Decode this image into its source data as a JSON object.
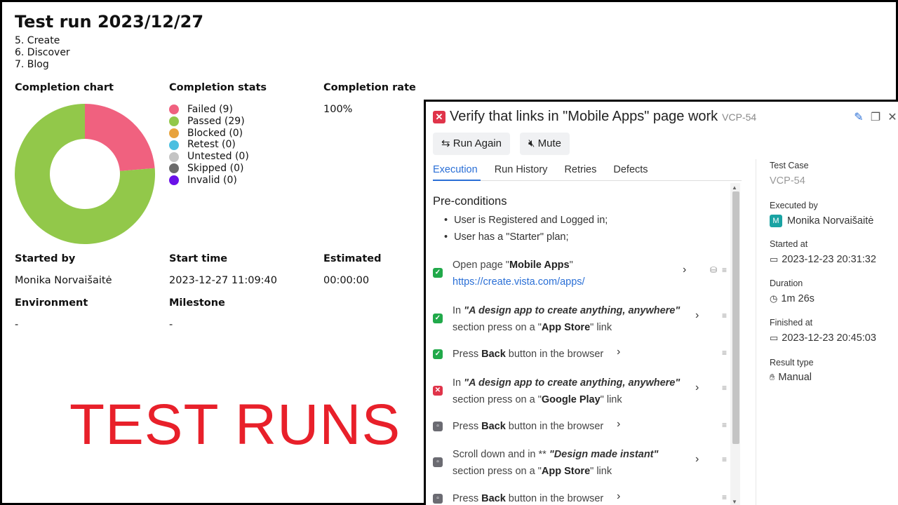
{
  "report": {
    "title": "Test run 2023/12/27",
    "sections": [
      "5. Create",
      "6. Discover",
      "7. Blog"
    ],
    "labels": {
      "completion_chart": "Completion chart",
      "completion_stats": "Completion stats",
      "completion_rate": "Completion rate",
      "started_by": "Started by",
      "start_time": "Start time",
      "estimated": "Estimated",
      "environment": "Environment",
      "milestone": "Milestone"
    },
    "values": {
      "completion_rate": "100%",
      "started_by": "Monika Norvaišaitė",
      "start_time": "2023-12-27 11:09:40",
      "estimated": "00:00:00",
      "environment": "-",
      "milestone": "-"
    },
    "stats": [
      {
        "label": "Failed (9)",
        "color": "#f0617f"
      },
      {
        "label": "Passed (29)",
        "color": "#92c84a"
      },
      {
        "label": "Blocked (0)",
        "color": "#e8a33d"
      },
      {
        "label": "Retest (0)",
        "color": "#4cbfe0"
      },
      {
        "label": "Untested (0)",
        "color": "#c4c4c4"
      },
      {
        "label": "Skipped (0)",
        "color": "#6b6b6b"
      },
      {
        "label": "Invalid (0)",
        "color": "#6a11e8"
      }
    ],
    "overlay_caption": "TEST RUNS"
  },
  "chart_data": {
    "type": "pie",
    "categories": [
      "Failed",
      "Passed"
    ],
    "values": [
      9,
      29
    ],
    "colors": [
      "#f0617f",
      "#92c84a"
    ],
    "title": "Completion chart",
    "donut": true
  },
  "panel": {
    "status_icon": "fail-icon",
    "title": "Verify that links in \"Mobile Apps\" page work",
    "case_id": "VCP-54",
    "buttons": {
      "run_again": "Run Again",
      "mute": "Mute"
    },
    "tabs": [
      "Execution",
      "Run History",
      "Retries",
      "Defects"
    ],
    "active_tab": "Execution",
    "preconditions_title": "Pre-conditions",
    "preconditions": [
      "User is Registered and Logged in;",
      "User has a \"Starter\" plan;"
    ],
    "steps": [
      {
        "status": "passed",
        "line1_pre": "Open page \"",
        "line1_bold": "Mobile Apps",
        "line1_post": "\"",
        "link": "https://create.vista.com/apps/"
      },
      {
        "status": "passed",
        "line1_pre": "In ",
        "line1_em": "\"A design app to create anything, anywhere\"",
        "line2_pre": "section press on a \"",
        "line2_bold": "App Store",
        "line2_post": "\" link"
      },
      {
        "status": "passed",
        "line1_pre": "Press ",
        "line1_bold": "Back",
        "line1_post": " button in the browser"
      },
      {
        "status": "failed",
        "line1_pre": "In ",
        "line1_em": "\"A design app to create anything, anywhere\"",
        "line2_pre": "section press on a \"",
        "line2_bold": "Google Play",
        "line2_post": "\" link"
      },
      {
        "status": "skipped",
        "line1_pre": "Press ",
        "line1_bold": "Back",
        "line1_post": " button in the browser"
      },
      {
        "status": "skipped",
        "line1_pre": "Scroll down and in ** ",
        "line1_em": "\"Design made instant\"",
        "line2_pre": "section press on a \"",
        "line2_bold": "App Store",
        "line2_post": "\" link"
      },
      {
        "status": "skipped",
        "line1_pre": "Press ",
        "line1_bold": "Back",
        "line1_post": " button in the browser"
      }
    ],
    "meta": {
      "test_case_label": "Test Case",
      "test_case_value": "VCP-54",
      "executed_by_label": "Executed by",
      "executed_by_initial": "M",
      "executed_by_value": "Monika Norvaišaitė",
      "started_at_label": "Started at",
      "started_at_value": "2023-12-23 20:31:32",
      "duration_label": "Duration",
      "duration_value": "1m 26s",
      "finished_at_label": "Finished at",
      "finished_at_value": "2023-12-23 20:45:03",
      "result_type_label": "Result type",
      "result_type_value": "Manual"
    }
  }
}
